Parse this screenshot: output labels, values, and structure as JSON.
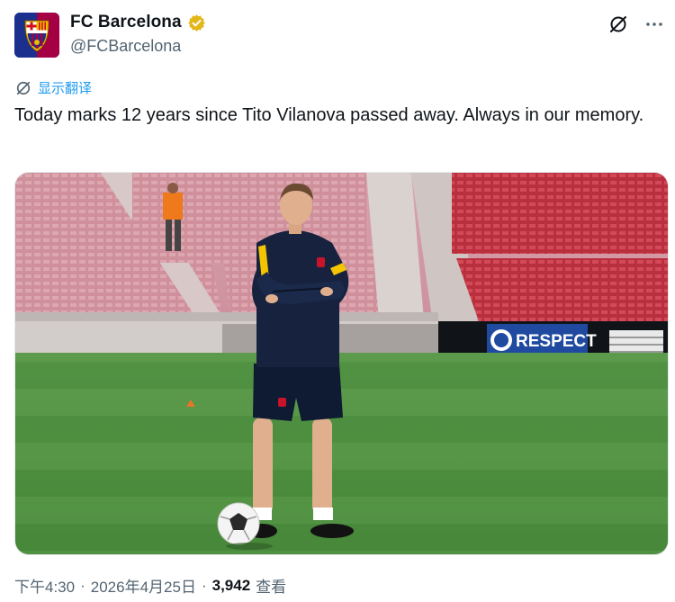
{
  "account": {
    "display_name": "FC Barcelona",
    "handle": "@FCBarcelona",
    "verified_icon": "verified-gold-badge-icon",
    "avatar_icon": "fc-barcelona-crest-icon"
  },
  "header_actions": {
    "grok_icon": "slashed-circle-icon",
    "more_icon": "more-dots-icon"
  },
  "translate": {
    "icon": "translate-icon",
    "label": "显示翻译"
  },
  "tweet": {
    "text": "Today marks 12 years since Tito Vilanova passed away. Always in our memory."
  },
  "media": {
    "banner_text": "RESPECT"
  },
  "meta": {
    "time": "下午4:30",
    "separator": "·",
    "date": "2026年4月25日",
    "views_count": "3,942",
    "views_label": "查看"
  },
  "colors": {
    "link": "#1d9bf0",
    "secondary": "#536471",
    "text": "#0f1419",
    "verified": "#e2b719"
  }
}
